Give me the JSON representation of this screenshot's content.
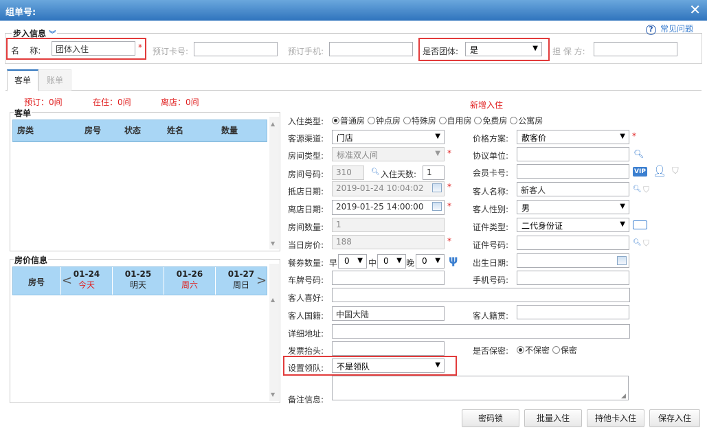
{
  "window": {
    "title": "组单号:"
  },
  "help": {
    "label": "常见问题"
  },
  "step": {
    "title": "步入信息",
    "name_label": "名    称:",
    "name_value": "团体入住",
    "card_label": "预订卡号:",
    "phone_label": "预订手机:",
    "group_label": "是否团体:",
    "group_value": "是",
    "guarantor_label": "担 保 方:"
  },
  "tabs": [
    {
      "label": "客单"
    },
    {
      "label": "账单"
    }
  ],
  "summary": {
    "reserved": "预订：0间",
    "staying": "在住：0间",
    "leaving": "离店：0间",
    "add_title": "新增入住"
  },
  "orders": {
    "title": "客单",
    "columns": [
      "房类",
      "房号",
      "状态",
      "姓名",
      "数量"
    ]
  },
  "prices": {
    "title": "房价信息",
    "room_col": "房号",
    "days": [
      {
        "date": "01-24",
        "label": "今天",
        "red": true
      },
      {
        "date": "01-25",
        "label": "明天",
        "red": false
      },
      {
        "date": "01-26",
        "label": "周六",
        "red": true
      },
      {
        "date": "01-27",
        "label": "周日",
        "red": false
      }
    ]
  },
  "form": {
    "checkin_type_label": "入住类型:",
    "checkin_types": [
      "普通房",
      "钟点房",
      "特殊房",
      "自用房",
      "免费房",
      "公寓房"
    ],
    "source_label": "客源渠道:",
    "source_value": "门店",
    "price_plan_label": "价格方案:",
    "price_plan_value": "散客价",
    "room_type_label": "房间类型:",
    "room_type_value": "标准双人间",
    "agreement_label": "协议单位:",
    "room_no_label": "房间号码:",
    "room_no_value": "310",
    "days_label": "入住天数:",
    "days_value": "1",
    "member_label": "会员卡号:",
    "arrive_label": "抵店日期:",
    "arrive_value": "2019-01-24 10:04:02",
    "guest_name_label": "客人名称:",
    "guest_name_value": "新客人",
    "depart_label": "离店日期:",
    "depart_value": "2019-01-25 14:00:00",
    "gender_label": "客人性别:",
    "gender_value": "男",
    "room_count_label": "房间数量:",
    "room_count_value": "1",
    "id_type_label": "证件类型:",
    "id_type_value": "二代身份证",
    "day_price_label": "当日房价:",
    "day_price_value": "188",
    "id_no_label": "证件号码:",
    "meal_label": "餐券数量:",
    "breakfast": "早",
    "breakfast_value": "0",
    "lunch": "中",
    "lunch_value": "0",
    "dinner": "晚",
    "dinner_value": "0",
    "birth_label": "出生日期:",
    "plate_label": "车牌号码:",
    "mobile_label": "手机号码:",
    "hobby_label": "客人喜好:",
    "nation_label": "客人国籍:",
    "nation_value": "中国大陆",
    "origin_label": "客人籍贯:",
    "address_label": "详细地址:",
    "invoice_label": "发票抬头:",
    "secret_label": "是否保密:",
    "secret_options": [
      "不保密",
      "保密"
    ],
    "leader_label": "设置领队:",
    "leader_value": "不是领队",
    "remark_label": "备注信息:"
  },
  "buttons": {
    "password_lock": "密码锁",
    "batch_checkin": "批量入住",
    "other_card": "持他卡入住",
    "save_checkin": "保存入住"
  },
  "colors": {
    "accent": "#2f74bd",
    "highlight": "#e23b3b",
    "grid_header": "#a9d6f5"
  }
}
